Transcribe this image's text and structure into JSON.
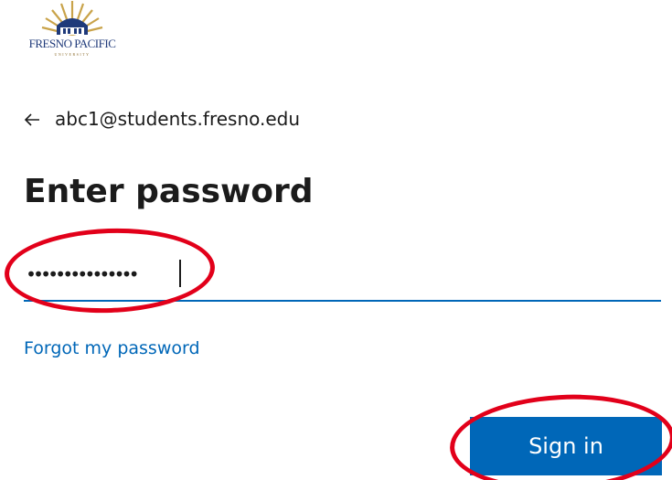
{
  "logo": {
    "name": "FRESNO PACIFIC",
    "sub": "UNIVERSITY"
  },
  "identity": {
    "email": "abc1@students.fresno.edu",
    "back_icon": "back-arrow-icon"
  },
  "title": "Enter password",
  "password": {
    "masked_value": "•••••••••••••••",
    "type": "password"
  },
  "links": {
    "forgot": "Forgot my password"
  },
  "buttons": {
    "sign_in": "Sign in"
  },
  "colors": {
    "accent": "#0067b8",
    "annotation": "#e2001a",
    "logo_blue": "#1f3a7a",
    "logo_gold": "#c9a34a"
  }
}
